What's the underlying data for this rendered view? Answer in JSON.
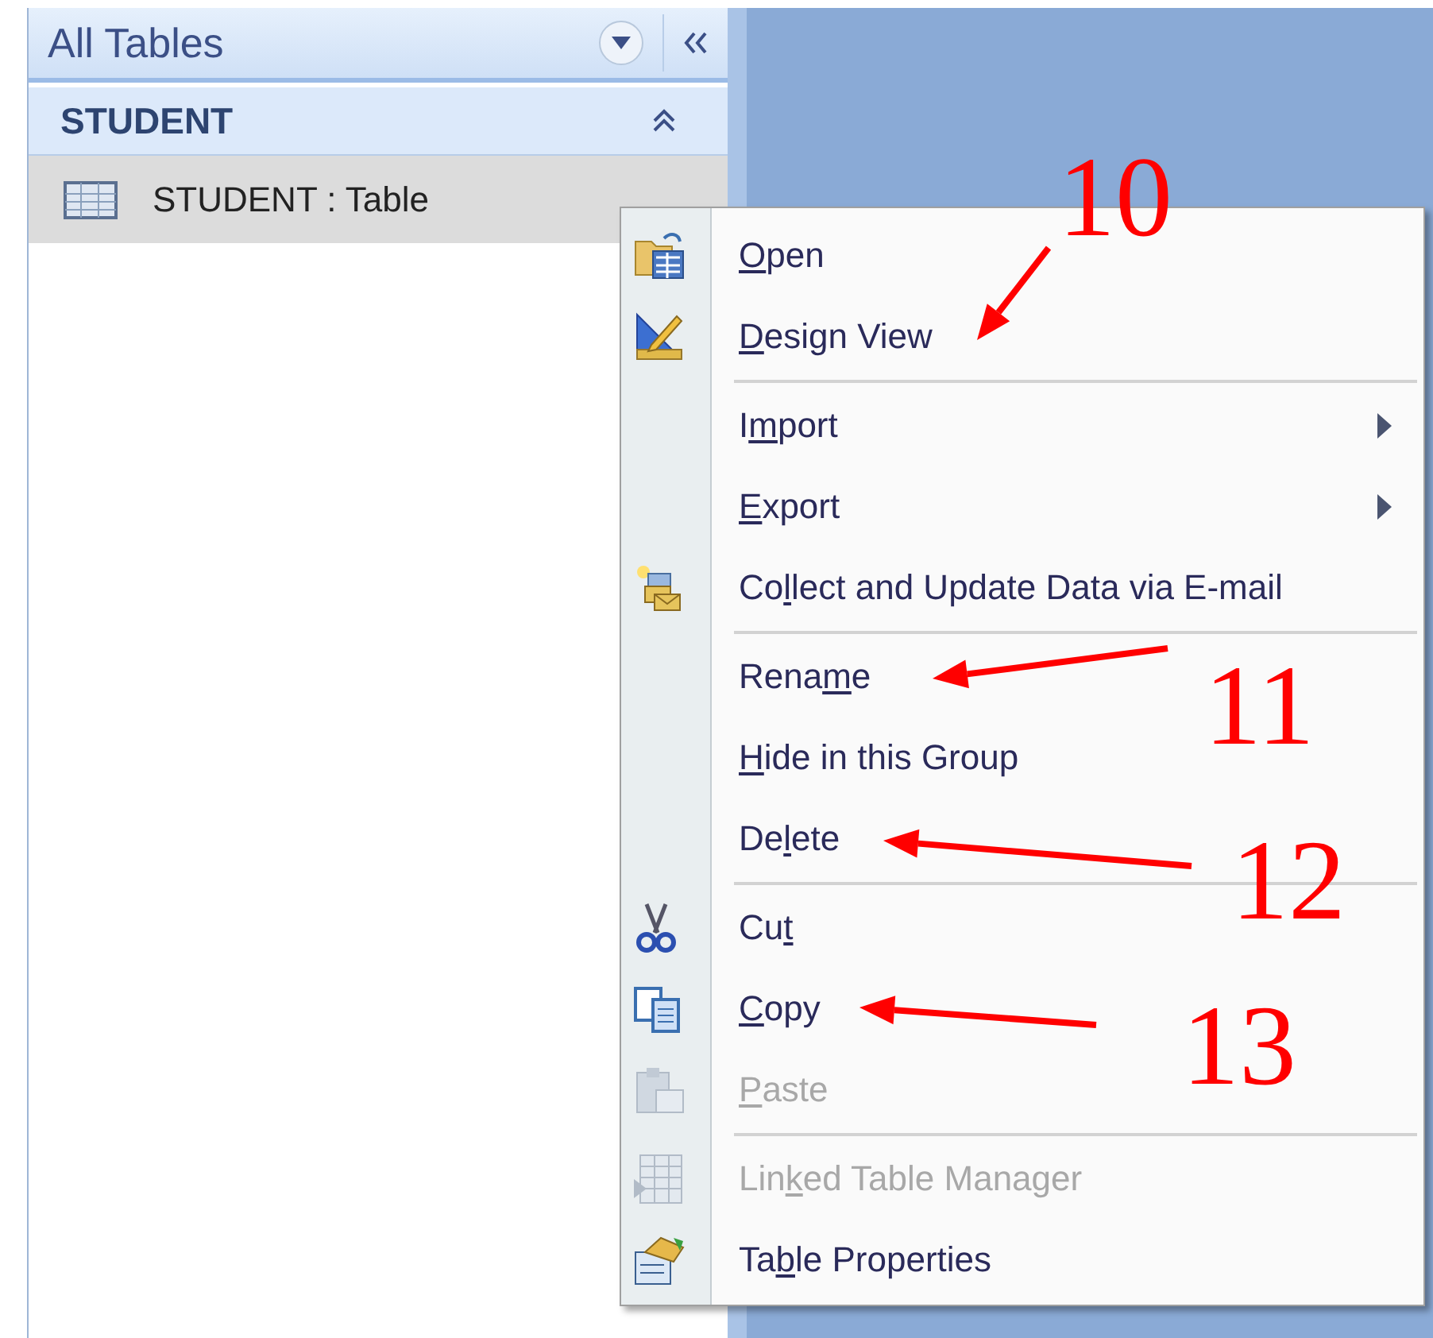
{
  "nav_pane": {
    "title": "All Tables",
    "group": {
      "title": "STUDENT",
      "expanded": true,
      "items": [
        {
          "label": "STUDENT : Table",
          "selected": true
        }
      ]
    }
  },
  "context_menu": {
    "items": [
      {
        "kind": "command",
        "key": "O",
        "post": "pen",
        "disabled": false
      },
      {
        "kind": "command",
        "key": "D",
        "post": "esign View",
        "disabled": false
      },
      {
        "kind": "separator"
      },
      {
        "kind": "submenu",
        "pre": "I",
        "key": "m",
        "post": "port",
        "disabled": false
      },
      {
        "kind": "submenu",
        "key": "E",
        "post": "xport",
        "disabled": false
      },
      {
        "kind": "command",
        "pre": "Co",
        "key": "l",
        "post": "lect and Update Data via E-mail",
        "disabled": false
      },
      {
        "kind": "separator"
      },
      {
        "kind": "command",
        "pre": "Rena",
        "key": "m",
        "post": "e",
        "disabled": false
      },
      {
        "kind": "command",
        "key": "H",
        "post": "ide in this Group",
        "disabled": false
      },
      {
        "kind": "command",
        "pre": "De",
        "key": "l",
        "post": "ete",
        "disabled": false
      },
      {
        "kind": "separator"
      },
      {
        "kind": "command",
        "pre": "Cu",
        "key": "t",
        "disabled": false
      },
      {
        "kind": "command",
        "key": "C",
        "post": "opy",
        "disabled": false
      },
      {
        "kind": "command",
        "key": "P",
        "post": "aste",
        "disabled": true
      },
      {
        "kind": "separator"
      },
      {
        "kind": "command",
        "pre": "Lin",
        "key": "k",
        "post": "ed Table Manager",
        "disabled": true
      },
      {
        "kind": "command",
        "pre": "Ta",
        "key": "b",
        "post": "le Properties",
        "disabled": false
      }
    ]
  },
  "annotations": [
    {
      "label": "10"
    },
    {
      "label": "11"
    },
    {
      "label": "12"
    },
    {
      "label": "13"
    }
  ]
}
